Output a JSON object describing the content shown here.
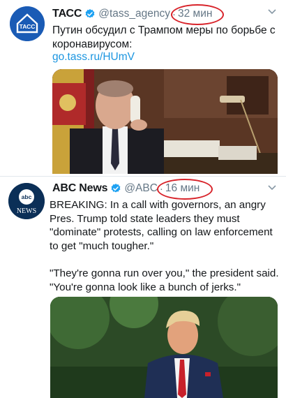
{
  "tweets": [
    {
      "author_name": "ТАСС",
      "avatar_text": "ТАСС",
      "handle": "@tass_agency",
      "separator": "·",
      "time": "32 мин",
      "text": "Путин обсудил с Трампом меры по борьбе с коронавирусом:",
      "link": "go.tass.ru/HUmV"
    },
    {
      "author_name": "ABC News",
      "avatar_text_top": "abc",
      "avatar_text_bottom": "NEWS",
      "handle": "@ABC",
      "separator": "·",
      "time": "16 мин",
      "text": "BREAKING: In a call with governors, an angry Pres. Trump told state leaders they must \"dominate\" protests, calling on law enforcement to get \"much tougher.\"\n\n\"They're gonna run over you,\" the president said. \"You're gonna look like a bunch of jerks.\""
    }
  ],
  "colors": {
    "verified": "#1da1f2",
    "highlight_ring": "#d8232a",
    "link": "#1b95e0",
    "muted": "#657786"
  },
  "icons": {
    "caret": "chevron-down-icon",
    "verified": "verified-badge-icon"
  }
}
